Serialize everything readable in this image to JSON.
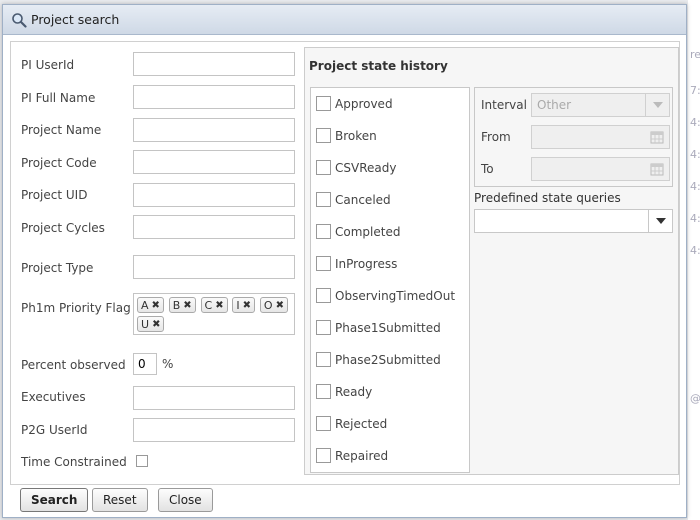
{
  "dialog": {
    "title": "Project search"
  },
  "form": {
    "pi_userid": {
      "label": "PI UserId",
      "value": ""
    },
    "pi_fullname": {
      "label": "PI Full Name",
      "value": ""
    },
    "project_name": {
      "label": "Project Name",
      "value": ""
    },
    "project_code": {
      "label": "Project Code",
      "value": ""
    },
    "project_uid": {
      "label": "Project UID",
      "value": ""
    },
    "project_cycles": {
      "label": "Project Cycles",
      "value": ""
    },
    "project_type": {
      "label": "Project Type",
      "value": ""
    },
    "priority_flag": {
      "label": "Ph1m Priority Flag",
      "tags": [
        "A",
        "B",
        "C",
        "I",
        "O",
        "U"
      ]
    },
    "percent_observed": {
      "label": "Percent observed",
      "value": "0",
      "unit": "%"
    },
    "executives": {
      "label": "Executives",
      "value": ""
    },
    "p2g_userid": {
      "label": "P2G UserId",
      "value": ""
    },
    "time_constrained": {
      "label": "Time Constrained",
      "checked": false
    }
  },
  "state_history": {
    "title": "Project state history",
    "states": [
      {
        "name": "Approved",
        "checked": false
      },
      {
        "name": "Broken",
        "checked": false
      },
      {
        "name": "CSVReady",
        "checked": false
      },
      {
        "name": "Canceled",
        "checked": false
      },
      {
        "name": "Completed",
        "checked": false
      },
      {
        "name": "InProgress",
        "checked": false
      },
      {
        "name": "ObservingTimedOut",
        "checked": false
      },
      {
        "name": "Phase1Submitted",
        "checked": false
      },
      {
        "name": "Phase2Submitted",
        "checked": false
      },
      {
        "name": "Ready",
        "checked": false
      },
      {
        "name": "Rejected",
        "checked": false
      },
      {
        "name": "Repaired",
        "checked": false
      }
    ],
    "interval": {
      "label": "Interval",
      "value": "Other"
    },
    "from": {
      "label": "From",
      "value": ""
    },
    "to": {
      "label": "To",
      "value": ""
    },
    "predefined": {
      "label": "Predefined state queries",
      "value": ""
    }
  },
  "buttons": {
    "search": "Search",
    "reset": "Reset",
    "close": "Close"
  },
  "icons": {
    "title": "search-icon",
    "calendar": "calendar-icon",
    "dropdown": "chevron-down-icon",
    "tag_remove": "close-icon"
  },
  "colors": {
    "titlebar": "#d8e1ec",
    "panel_bg": "#f6f6f6",
    "disabled_bg": "#efefef"
  }
}
